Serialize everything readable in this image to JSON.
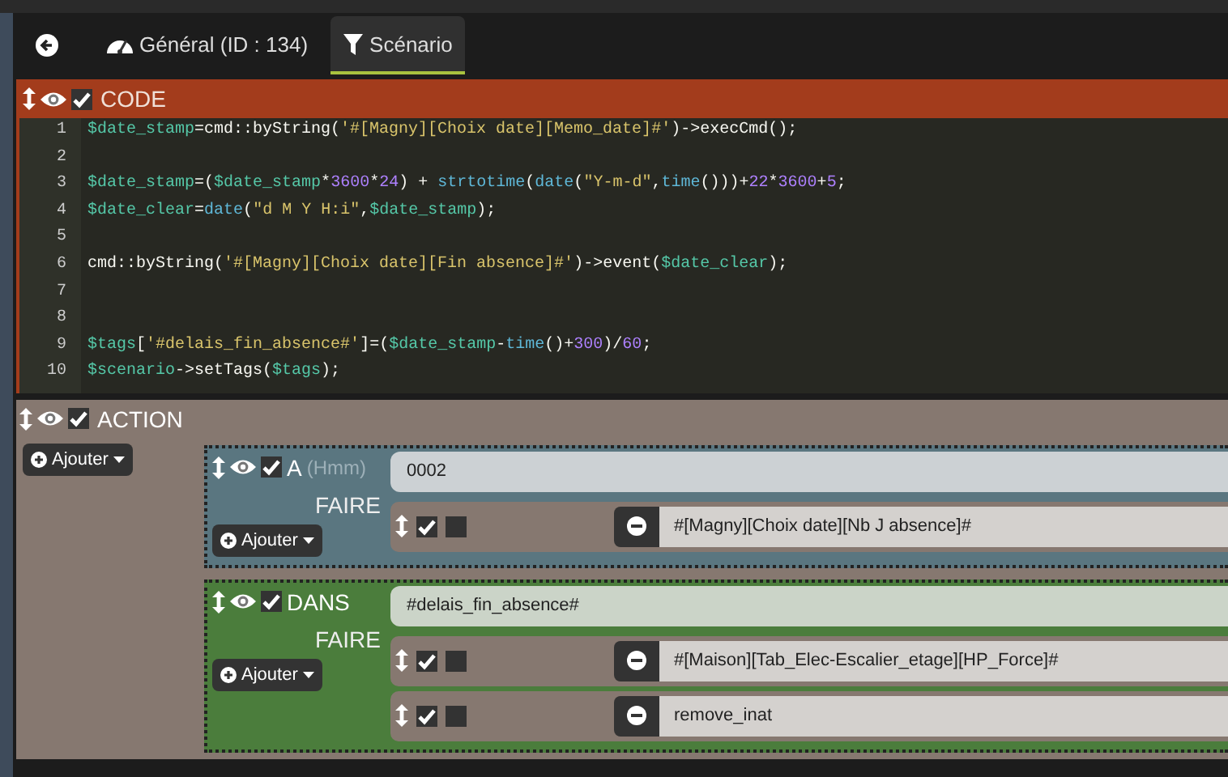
{
  "tabs": [
    {
      "kind": "gauge",
      "label": "Général (ID : 134)",
      "selected": false
    },
    {
      "kind": "filter",
      "label": "Scénario",
      "selected": true
    }
  ],
  "blocks": [
    {
      "kind": "code",
      "title": "CODE",
      "enabled": true,
      "lines": [
        {
          "number": "1",
          "tokens": [
            {
              "kind": "var",
              "text": "$date_stamp"
            },
            {
              "kind": "plain",
              "text": "=cmd::byString("
            },
            {
              "kind": "str",
              "text": "'#[Magny][Choix date][Memo_date]#'"
            },
            {
              "kind": "plain",
              "text": ")->execCmd();"
            }
          ]
        },
        {
          "number": "2"
        },
        {
          "number": "3",
          "tokens": [
            {
              "kind": "var",
              "text": "$date_stamp"
            },
            {
              "kind": "plain",
              "text": "=("
            },
            {
              "kind": "var",
              "text": "$date_stamp"
            },
            {
              "kind": "plain",
              "text": "*"
            },
            {
              "kind": "num",
              "text": "3600"
            },
            {
              "kind": "plain",
              "text": "*"
            },
            {
              "kind": "num",
              "text": "24"
            },
            {
              "kind": "plain",
              "text": ") + "
            },
            {
              "kind": "fn",
              "text": "strtotime"
            },
            {
              "kind": "plain",
              "text": "("
            },
            {
              "kind": "fn",
              "text": "date"
            },
            {
              "kind": "plain",
              "text": "("
            },
            {
              "kind": "str",
              "text": "\"Y-m-d\""
            },
            {
              "kind": "plain",
              "text": ","
            },
            {
              "kind": "fn",
              "text": "time"
            },
            {
              "kind": "plain",
              "text": "()))+"
            },
            {
              "kind": "num",
              "text": "22"
            },
            {
              "kind": "plain",
              "text": "*"
            },
            {
              "kind": "num",
              "text": "3600"
            },
            {
              "kind": "plain",
              "text": "+"
            },
            {
              "kind": "num",
              "text": "5"
            },
            {
              "kind": "plain",
              "text": ";"
            }
          ]
        },
        {
          "number": "4",
          "tokens": [
            {
              "kind": "var",
              "text": "$date_clear"
            },
            {
              "kind": "plain",
              "text": "="
            },
            {
              "kind": "fn",
              "text": "date"
            },
            {
              "kind": "plain",
              "text": "("
            },
            {
              "kind": "str",
              "text": "\"d M Y H:i\""
            },
            {
              "kind": "plain",
              "text": ","
            },
            {
              "kind": "var",
              "text": "$date_stamp"
            },
            {
              "kind": "plain",
              "text": ");"
            }
          ]
        },
        {
          "number": "5"
        },
        {
          "number": "6",
          "tokens": [
            {
              "kind": "plain",
              "text": "cmd::byString("
            },
            {
              "kind": "str",
              "text": "'#[Magny][Choix date][Fin absence]#'"
            },
            {
              "kind": "plain",
              "text": ")->event("
            },
            {
              "kind": "var",
              "text": "$date_clear"
            },
            {
              "kind": "plain",
              "text": ");"
            }
          ]
        },
        {
          "number": "7"
        },
        {
          "number": "8"
        },
        {
          "number": "9",
          "tokens": [
            {
              "kind": "var",
              "text": "$tags"
            },
            {
              "kind": "plain",
              "text": "["
            },
            {
              "kind": "str",
              "text": "'#delais_fin_absence#'"
            },
            {
              "kind": "plain",
              "text": "]=("
            },
            {
              "kind": "var",
              "text": "$date_stamp"
            },
            {
              "kind": "plain",
              "text": "-"
            },
            {
              "kind": "fn",
              "text": "time"
            },
            {
              "kind": "plain",
              "text": "()+"
            },
            {
              "kind": "num",
              "text": "300"
            },
            {
              "kind": "plain",
              "text": ")/"
            },
            {
              "kind": "num",
              "text": "60"
            },
            {
              "kind": "plain",
              "text": ";"
            }
          ]
        },
        {
          "number": "10",
          "tokens": [
            {
              "kind": "var",
              "text": "$scenario"
            },
            {
              "kind": "plain",
              "text": "->setTags("
            },
            {
              "kind": "var",
              "text": "$tags"
            },
            {
              "kind": "plain",
              "text": ");"
            }
          ]
        }
      ]
    },
    {
      "kind": "action",
      "title": "ACTION",
      "enabled": true,
      "add_button": "Ajouter",
      "elements": [
        {
          "kind": "time",
          "label": "A",
          "hint": "(Hmm)",
          "value": "0002",
          "enabled": true,
          "do_label": "FAIRE",
          "add_button": "Ajouter",
          "actions": [
            {
              "enabled": true,
              "option": false,
              "value": "#[Magny][Choix date][Nb J absence]#"
            }
          ]
        },
        {
          "kind": "delay",
          "label": "DANS",
          "value": "#delais_fin_absence#",
          "enabled": true,
          "do_label": "FAIRE",
          "add_button": "Ajouter",
          "actions": [
            {
              "enabled": true,
              "option": false,
              "value": "#[Maison][Tab_Elec-Escalier_etage][HP_Force]#"
            },
            {
              "enabled": true,
              "option": false,
              "value": "remove_inat"
            }
          ]
        }
      ]
    }
  ]
}
